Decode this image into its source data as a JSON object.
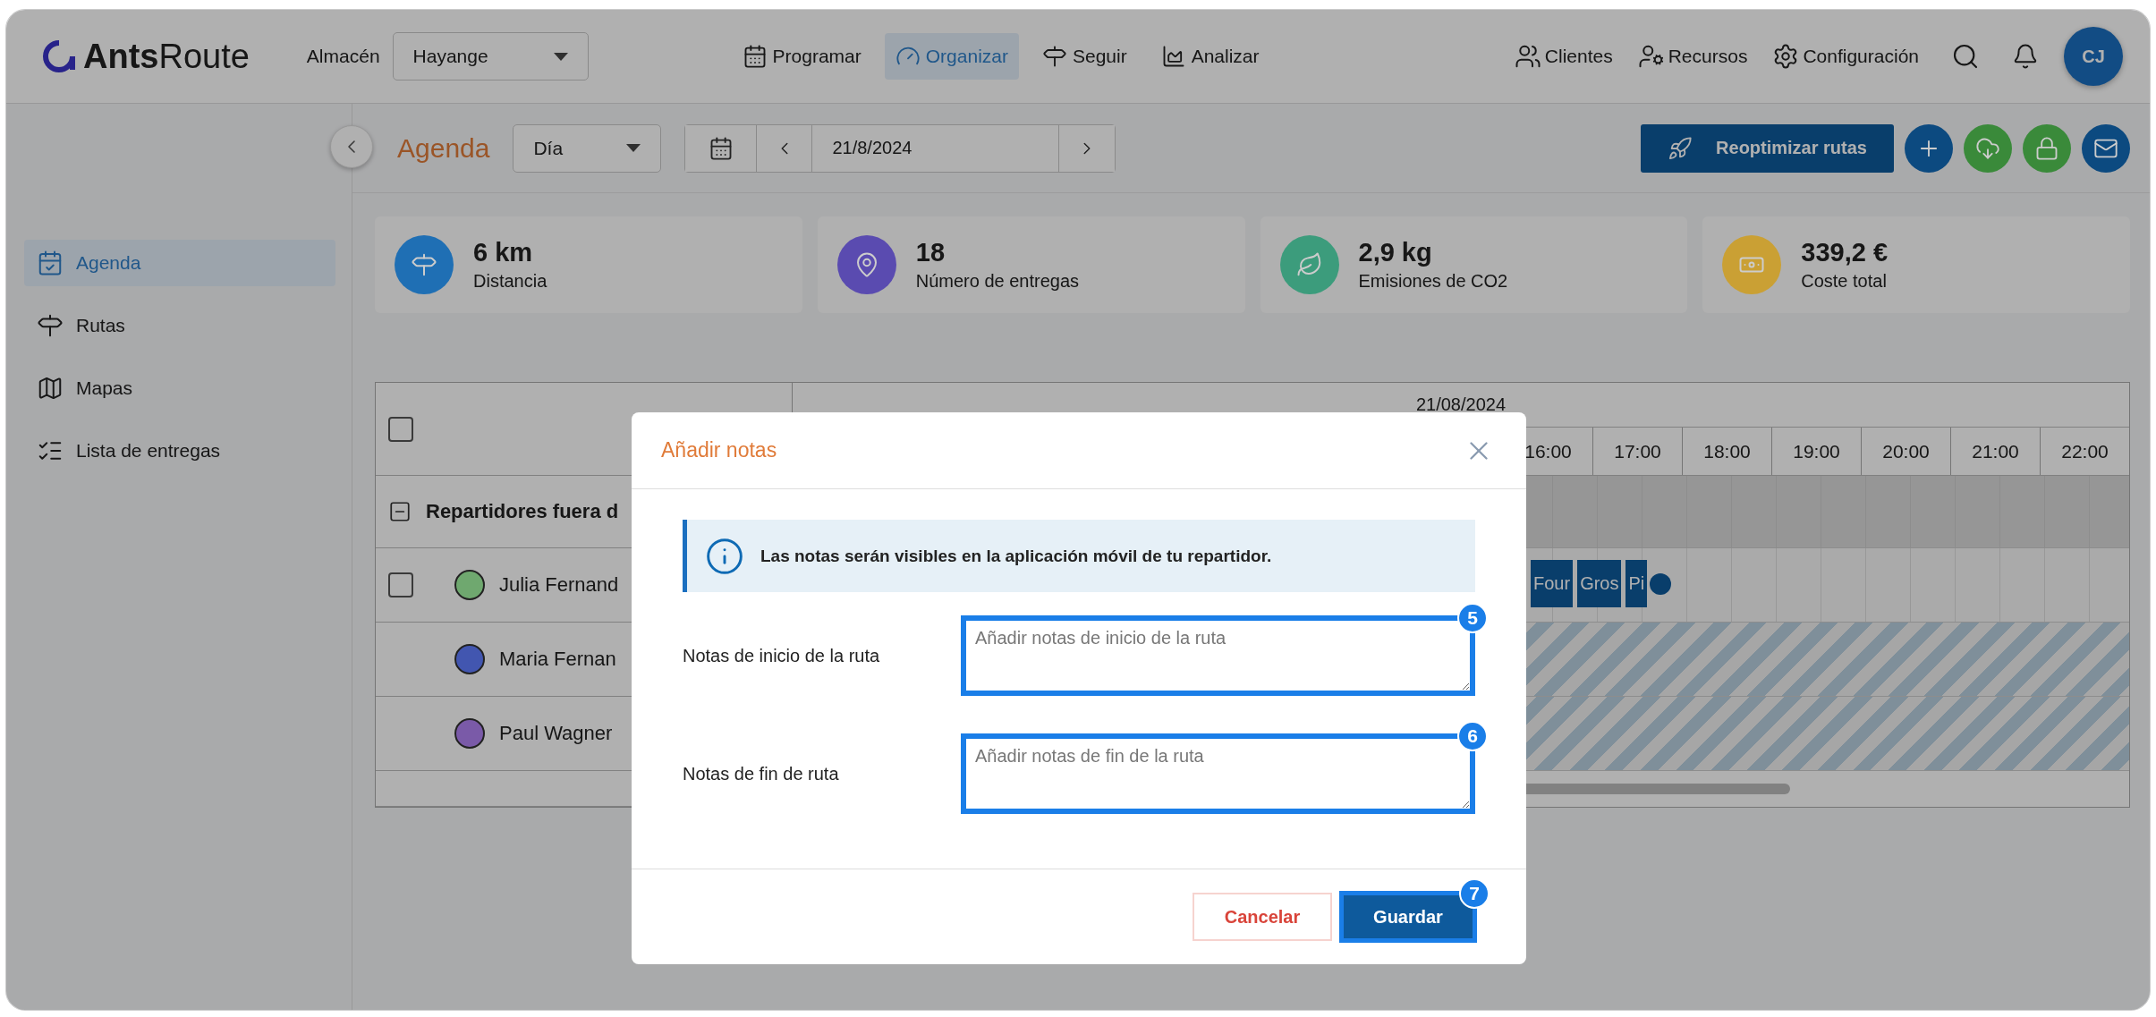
{
  "header": {
    "logo": "**Ants**Route",
    "warehouse_label": "Almacén",
    "warehouse_select": "Hayange",
    "nav": [
      {
        "label": "Programar",
        "selected": false
      },
      {
        "label": "Organizar",
        "selected": true
      },
      {
        "label": "Seguir",
        "selected": false
      },
      {
        "label": "Analizar",
        "selected": false
      }
    ],
    "tools": [
      {
        "label": "Clientes"
      },
      {
        "label": "Recursos"
      },
      {
        "label": "Configuración"
      }
    ],
    "avatar": "CJ"
  },
  "sidebar": {
    "items": [
      {
        "label": "Agenda",
        "selected": true
      },
      {
        "label": "Rutas",
        "selected": false
      },
      {
        "label": "Mapas",
        "selected": false
      },
      {
        "label": "Lista de entregas",
        "selected": false
      }
    ]
  },
  "toolbar": {
    "title": "Agenda",
    "view_select": "Día",
    "date": "21/8/2024",
    "primary_button": "Reoptimizar rutas",
    "round_buttons": [
      {
        "color": "#0c4a80"
      },
      {
        "color": "#3a8a3a"
      },
      {
        "color": "#3a8a3a"
      },
      {
        "color": "#0c4a80"
      }
    ]
  },
  "stats": [
    {
      "value": "6 km",
      "label": "Distancia",
      "color": "#1f6fb4"
    },
    {
      "value": "18",
      "label": "Número de entregas",
      "color": "#5a4bb0"
    },
    {
      "value": "2,9 kg",
      "label": "Emisiones de CO2",
      "color": "#3c9c7c"
    },
    {
      "value": "339,2 €",
      "label": "Coste total",
      "color": "#caa034"
    }
  ],
  "table": {
    "header_checkbox": {
      "checked": false
    },
    "date": "21/08/2024",
    "hours": [
      "16:00",
      "17:00",
      "18:00",
      "19:00",
      "20:00",
      "21:00",
      "22:00"
    ],
    "group": {
      "label": "Repartidores fuera d",
      "expanded": true
    },
    "rows": [
      {
        "name": "Julia Fernand",
        "color": "#6fa86f",
        "checkbox": {
          "checked": false
        },
        "kind": "route",
        "stops": [
          "Four",
          "Gros",
          "Pi"
        ]
      },
      {
        "name": "Maria Fernan",
        "color": "#4256b0",
        "kind": "off"
      },
      {
        "name": "Paul Wagner",
        "color": "#7a5aa8",
        "kind": "off"
      }
    ]
  },
  "modal": {
    "title": "Añadir notas",
    "info": "Las notas serán visibles en la aplicación móvil de tu repartidor.",
    "fields": [
      {
        "label": "Notas de inicio de la ruta",
        "placeholder": "Añadir notas de inicio de la ruta",
        "badge": "5"
      },
      {
        "label": "Notas de fin de ruta",
        "placeholder": "Añadir notas de fin de la ruta",
        "badge": "6"
      }
    ],
    "cancel": "Cancelar",
    "save": "Guardar",
    "save_badge": "7"
  }
}
